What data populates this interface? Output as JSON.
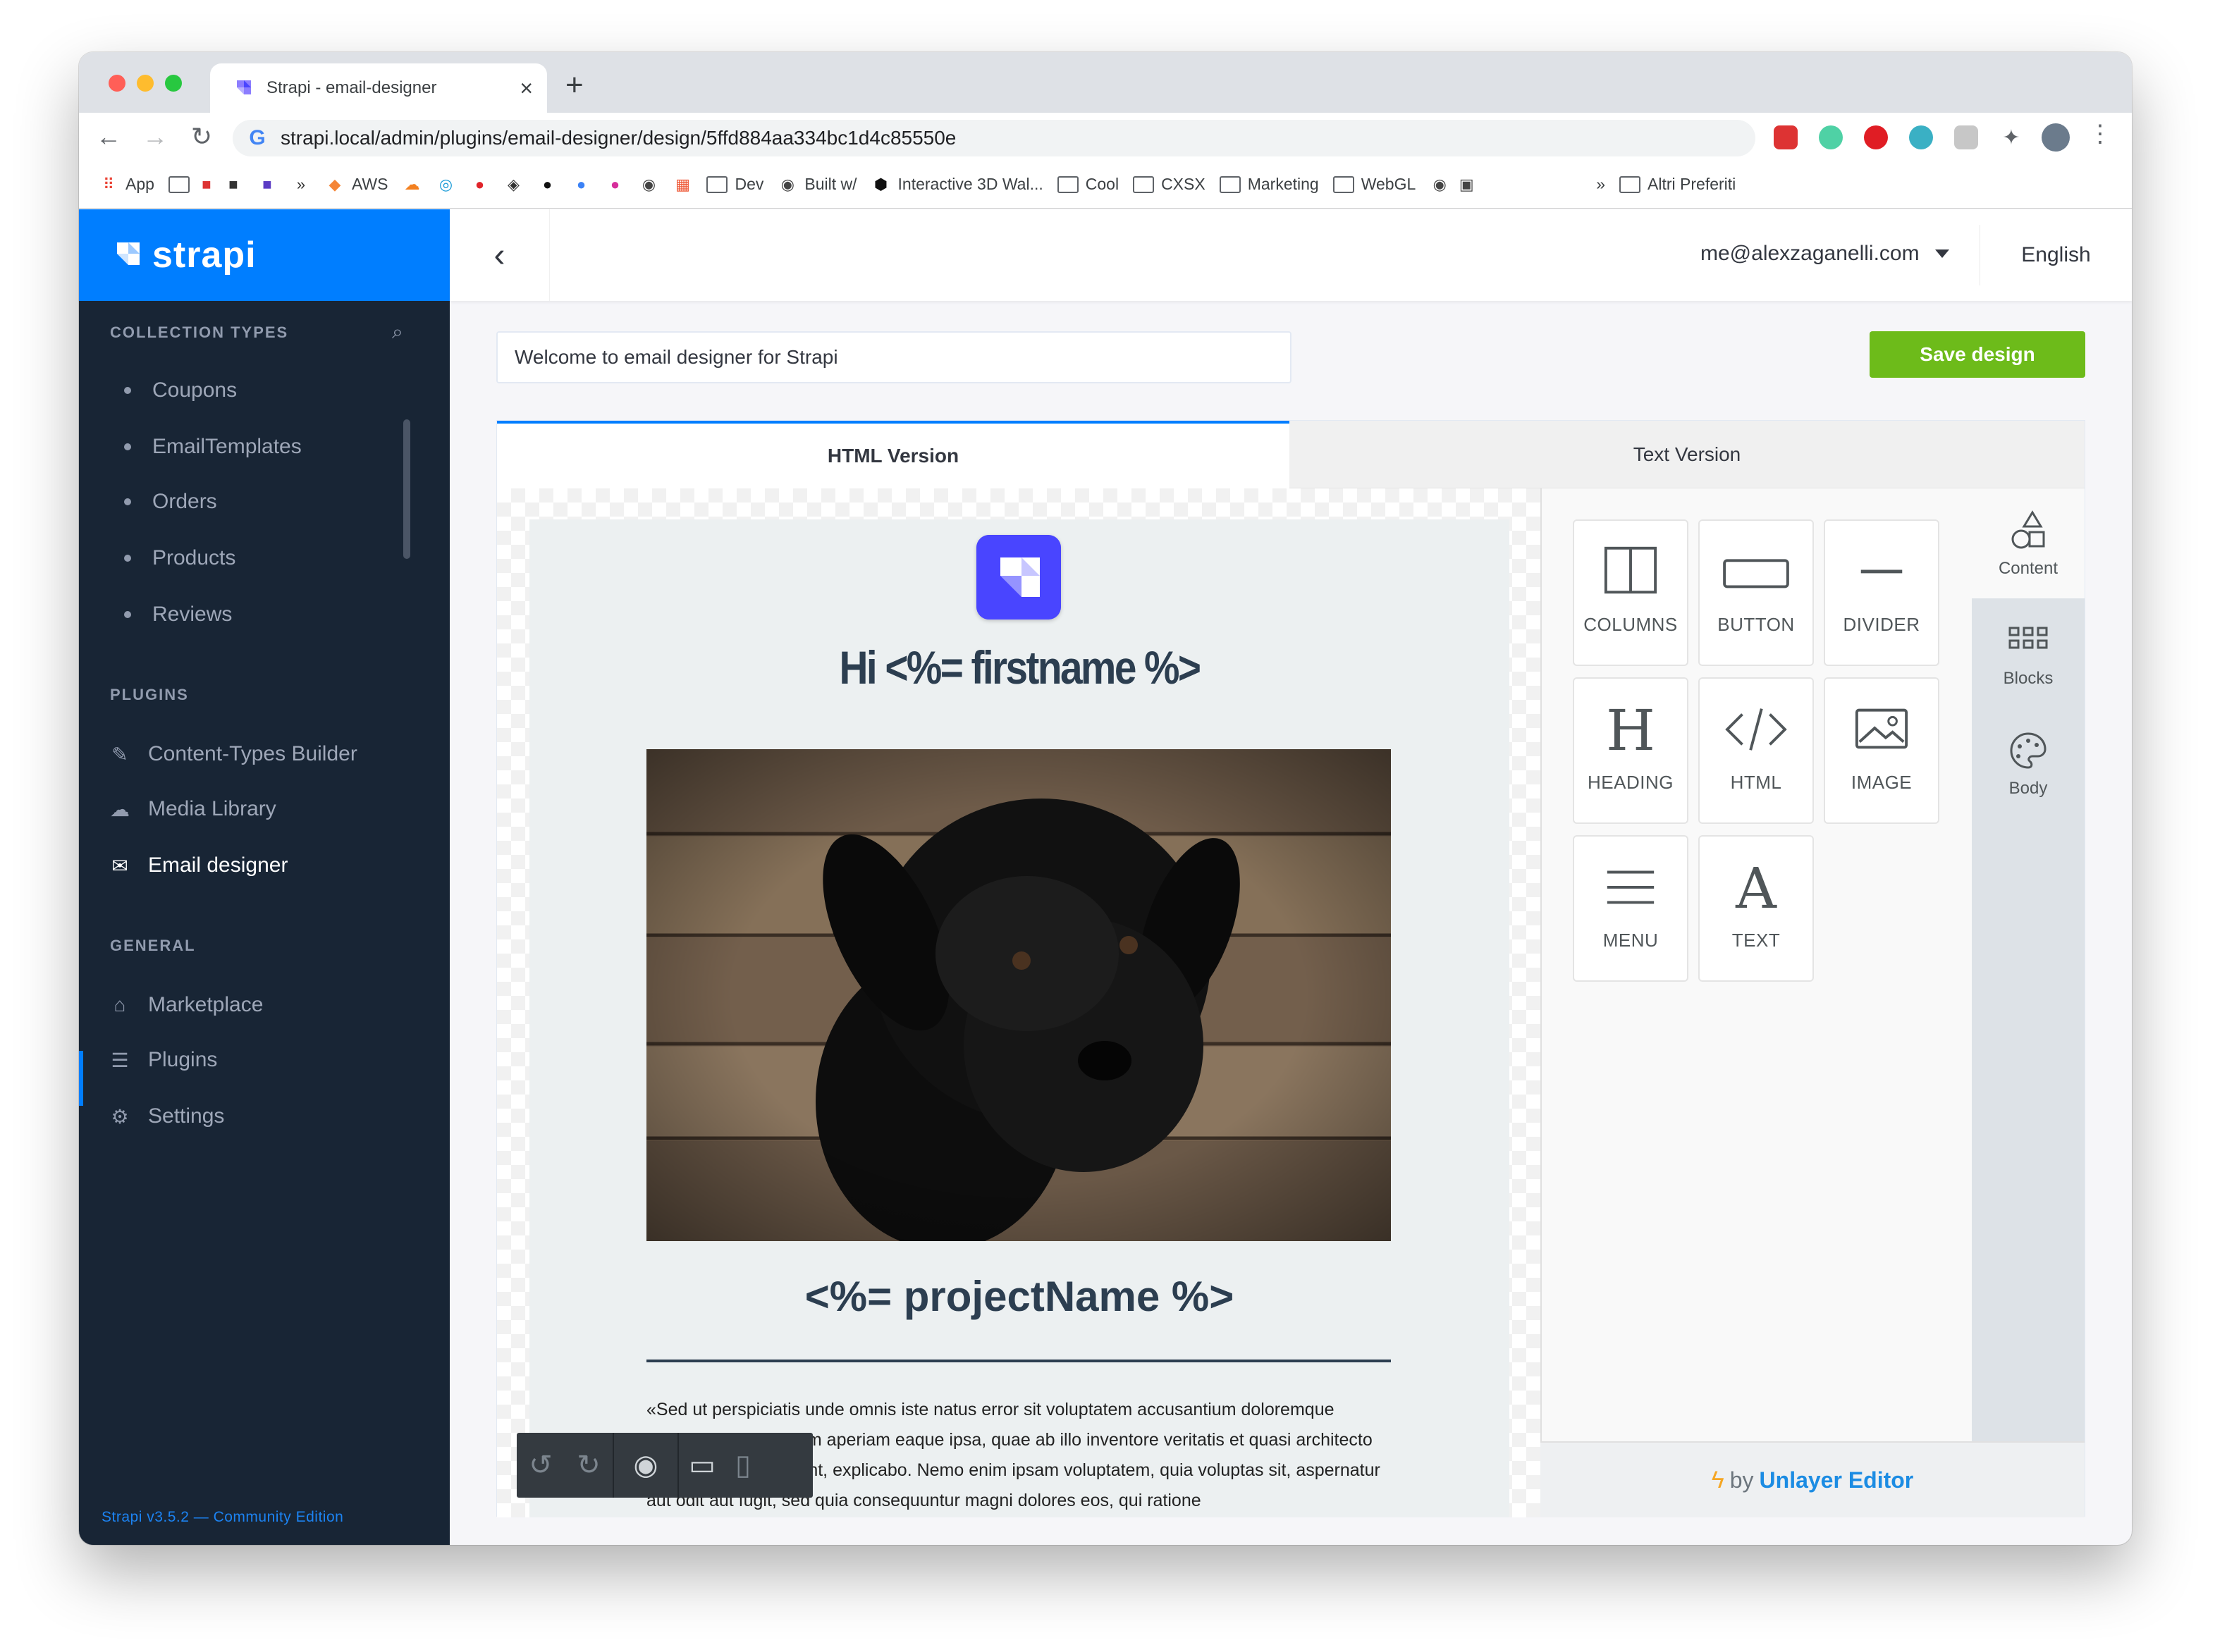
{
  "browser": {
    "tab_title": "Strapi - email-designer",
    "url": "strapi.local/admin/plugins/email-designer/design/5ffd884aa334bc1d4c85550e",
    "bookmarks": [
      "App",
      "AWS",
      "Dev",
      "Built w/",
      "Interactive 3D Wal...",
      "Cool",
      "CXSX",
      "Marketing",
      "WebGL",
      "»",
      "Altri Preferiti"
    ]
  },
  "sidebar": {
    "brand": "strapi",
    "collection_types_title": "COLLECTION TYPES",
    "collection_types": [
      "Coupons",
      "EmailTemplates",
      "Orders",
      "Products",
      "Reviews"
    ],
    "plugins_title": "PLUGINS",
    "plugins": [
      "Content-Types Builder",
      "Media Library",
      "Email designer"
    ],
    "general_title": "GENERAL",
    "general": [
      "Marketplace",
      "Plugins",
      "Settings"
    ],
    "footer": "Strapi v3.5.2 — Community Edition"
  },
  "header": {
    "user": "me@alexzaganelli.com",
    "language": "English"
  },
  "design": {
    "name_value": "Welcome to email designer for Strapi",
    "save_label": "Save design",
    "tabs": [
      "HTML Version",
      "Text Version"
    ]
  },
  "email": {
    "greeting": "Hi <%= firstname %>",
    "project": "<%= projectName %>",
    "body": "«Sed ut perspiciatis unde omnis iste natus error sit voluptatem accusantium doloremque laudantium, totam rem aperiam eaque ipsa, quae ab illo inventore veritatis et quasi architecto beatae vitae dicta sunt, explicabo. Nemo enim ipsam voluptatem, quia voluptas sit, aspernatur aut odit aut fugit, sed quia consequuntur magni dolores eos, qui ratione"
  },
  "tools": {
    "items": [
      "COLUMNS",
      "BUTTON",
      "DIVIDER",
      "HEADING",
      "HTML",
      "IMAGE",
      "MENU",
      "TEXT"
    ],
    "side_tabs": [
      "Content",
      "Blocks",
      "Body"
    ],
    "byline_prefix": "by",
    "byline_brand": "Unlayer Editor"
  },
  "colors": {
    "strapi_blue": "#007eff",
    "sidebar_bg": "#182535",
    "save_green": "#6dbb1a",
    "unlayer_blue": "#1c8ce3"
  }
}
